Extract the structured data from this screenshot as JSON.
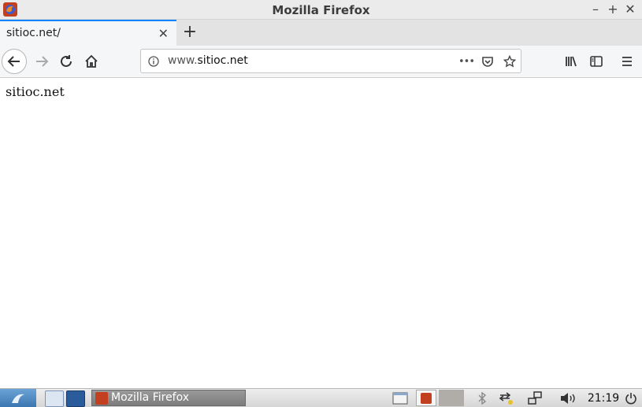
{
  "window": {
    "title": "Mozilla Firefox",
    "minimize_label": "–",
    "maximize_label": "+",
    "close_label": "✕"
  },
  "tabs": [
    {
      "title": "sitioc.net/",
      "close_label": "✕"
    }
  ],
  "new_tab_label": "+",
  "navbar": {
    "url_prefix": "www.",
    "url_host": "sitioc.net",
    "page_actions_label": "•••"
  },
  "page": {
    "body_text": "sitioc.net"
  },
  "taskbar": {
    "task_label": "Mozilla Firefox",
    "clock": "21:19"
  },
  "colors": {
    "tab_accent": "#0a84ff",
    "firefox_orange": "#c2401f",
    "start_blue": "#3c76b0"
  }
}
